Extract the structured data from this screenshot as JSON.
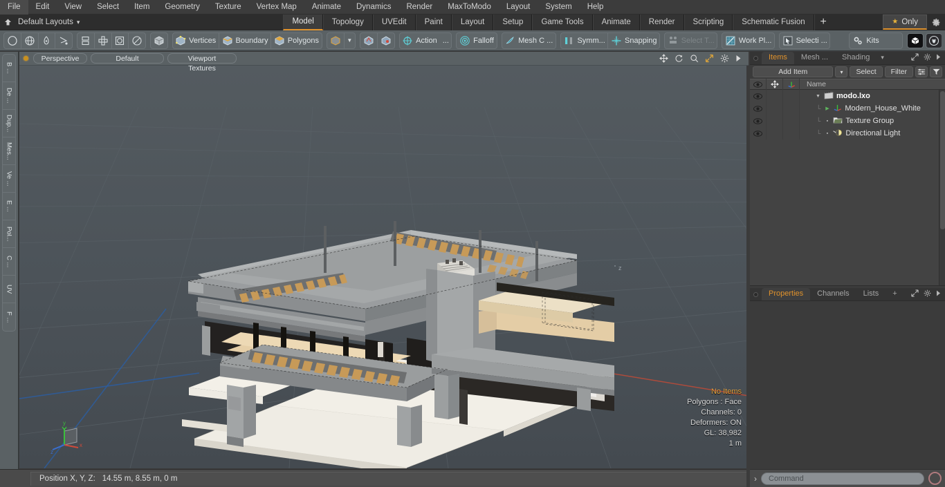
{
  "app": {
    "title": "Modo",
    "accent": "#e0922c",
    "toolbar_bg": "#5a6164",
    "viewport_bg": "#4e565c"
  },
  "menubar": {
    "items": [
      {
        "label": "File"
      },
      {
        "label": "Edit"
      },
      {
        "label": "View"
      },
      {
        "label": "Select"
      },
      {
        "label": "Item"
      },
      {
        "label": "Geometry"
      },
      {
        "label": "Texture"
      },
      {
        "label": "Vertex Map"
      },
      {
        "label": "Animate"
      },
      {
        "label": "Dynamics"
      },
      {
        "label": "Render"
      },
      {
        "label": "MaxToModo"
      },
      {
        "label": "Layout"
      },
      {
        "label": "System"
      },
      {
        "label": "Help"
      }
    ]
  },
  "layoutbar": {
    "home_icon": "home-icon",
    "layouts_label": "Default Layouts",
    "dropdown_glyph": "▾",
    "tabs": [
      {
        "label": "Model",
        "active": true
      },
      {
        "label": "Topology",
        "active": false
      },
      {
        "label": "UVEdit",
        "active": false
      },
      {
        "label": "Paint",
        "active": false
      },
      {
        "label": "Layout",
        "active": false
      },
      {
        "label": "Setup",
        "active": false
      },
      {
        "label": "Game Tools",
        "active": false
      },
      {
        "label": "Animate",
        "active": false
      },
      {
        "label": "Render",
        "active": false
      },
      {
        "label": "Scripting",
        "active": false
      },
      {
        "label": "Schematic Fusion",
        "active": false
      }
    ],
    "add_tab_label": "+",
    "only_label": "Only",
    "only_star": "★",
    "gear_icon": "gear-icon"
  },
  "toolbar": {
    "groups": [
      {
        "name": "primitives",
        "buttons": [
          {
            "icon": "circle-icon",
            "label": ""
          },
          {
            "icon": "globe-icon",
            "label": ""
          },
          {
            "icon": "pen-icon",
            "label": ""
          },
          {
            "icon": "curve-icon",
            "label": ""
          }
        ]
      },
      {
        "name": "duplicate-tools",
        "buttons": [
          {
            "icon": "stack-icon",
            "label": ""
          },
          {
            "icon": "radial-array-icon",
            "label": ""
          },
          {
            "icon": "bounding-box-icon",
            "label": ""
          },
          {
            "icon": "ellipse-icon",
            "label": ""
          }
        ]
      },
      {
        "name": "item-mode",
        "buttons": [
          {
            "icon": "cube-icon",
            "label": ""
          }
        ]
      },
      {
        "name": "selection-modes",
        "buttons": [
          {
            "icon": "vertices-icon",
            "label": "Vertices"
          },
          {
            "icon": "boundary-icon",
            "label": "Boundary"
          },
          {
            "icon": "polygons-icon",
            "label": "Polygons"
          }
        ]
      },
      {
        "name": "selection-extras",
        "buttons": [
          {
            "icon": "cube-orange-icon",
            "label": ""
          },
          {
            "icon": "chevron-down-icon",
            "label": ""
          }
        ]
      },
      {
        "name": "select-helpers",
        "buttons": [
          {
            "icon": "select-through-icon",
            "label": ""
          },
          {
            "icon": "select-backface-icon",
            "label": ""
          }
        ]
      },
      {
        "name": "action-center",
        "buttons": [
          {
            "icon": "action-center-icon",
            "label": "Action"
          },
          {
            "icon": "ellipsis-icon",
            "label": "..."
          }
        ]
      },
      {
        "name": "falloff",
        "buttons": [
          {
            "icon": "falloff-icon",
            "label": "Falloff"
          }
        ]
      },
      {
        "name": "mesh-constraint",
        "buttons": [
          {
            "icon": "mesh-constraint-icon",
            "label": "Mesh C ..."
          }
        ]
      },
      {
        "name": "symmetry-snapping",
        "buttons": [
          {
            "icon": "symmetry-icon",
            "label": "Symm..."
          },
          {
            "icon": "snapping-icon",
            "label": "Snapping"
          }
        ]
      },
      {
        "name": "select-through",
        "buttons": [
          {
            "icon": "select-through-icon",
            "label": "Select T...",
            "dim": true
          }
        ]
      },
      {
        "name": "work-plane",
        "buttons": [
          {
            "icon": "work-plane-icon",
            "label": "Work Pl..."
          }
        ]
      },
      {
        "name": "selection-sets",
        "buttons": [
          {
            "icon": "selection-icon",
            "label": "Selecti ..."
          }
        ]
      },
      {
        "name": "kits",
        "buttons": [
          {
            "icon": "kits-gear-icon",
            "label": "Kits"
          }
        ]
      },
      {
        "name": "plugins",
        "buttons": [
          {
            "icon": "modo-cube-icon",
            "label": ""
          },
          {
            "icon": "unreal-engine-icon",
            "label": ""
          }
        ]
      }
    ]
  },
  "left_strip": {
    "tabs": [
      {
        "label": "B ..."
      },
      {
        "label": "De ..."
      },
      {
        "label": "Dup..."
      },
      {
        "label": "Mes..."
      },
      {
        "label": "Ve ..."
      },
      {
        "label": "E ..."
      },
      {
        "label": "Pol..."
      },
      {
        "label": "C ..."
      },
      {
        "label": "UV"
      },
      {
        "label": "F ..."
      }
    ]
  },
  "viewport": {
    "header": {
      "active_dot": true,
      "pills": [
        {
          "label": "Perspective",
          "name": "viewport-projection-dropdown"
        },
        {
          "label": "Default",
          "name": "viewport-style-dropdown"
        },
        {
          "label": "Viewport Textures",
          "name": "viewport-textures-dropdown"
        }
      ],
      "tools": [
        {
          "icon": "pan-icon"
        },
        {
          "icon": "rotate-icon"
        },
        {
          "icon": "zoom-icon"
        },
        {
          "icon": "fit-icon"
        },
        {
          "icon": "gear-icon"
        },
        {
          "icon": "play-arrow-icon"
        }
      ]
    },
    "stats": {
      "no_items": "No Items",
      "polygons": "Polygons : Face",
      "channels": "Channels: 0",
      "deformers": "Deformers: ON",
      "gl": "GL: 38,982",
      "grid_unit": "1 m"
    },
    "axis_gizmo": {
      "x": "x",
      "y": "y",
      "z": "z"
    }
  },
  "statusbar": {
    "position_label": "Position X, Y, Z:",
    "position_value": "14.55 m, 8.55 m, 0 m"
  },
  "right_panel": {
    "top_tabs": [
      {
        "label": "Items",
        "active": true
      },
      {
        "label": "Mesh ...",
        "active": false
      },
      {
        "label": "Shading",
        "active": false
      }
    ],
    "top_tabs_dropdown": "▾",
    "items_toolbar": {
      "add_item": "Add Item",
      "add_item_dropdown": "▾",
      "select": "Select",
      "filter": "Filter",
      "list_icon": "list-options-icon",
      "funnel_icon": "funnel-icon"
    },
    "columns": {
      "eye": "eye-icon",
      "lock": "move-lock-icon",
      "axis": "axis-icon",
      "name": "Name"
    },
    "tree": [
      {
        "label": "modo.lxo",
        "icon": "scene-icon",
        "depth": 0,
        "expander": "▼",
        "root": true
      },
      {
        "label": "Modern_House_White",
        "icon": "mesh-axis-icon",
        "depth": 1,
        "expander": "▶",
        "root": false
      },
      {
        "label": "Texture Group",
        "icon": "texture-group-icon",
        "depth": 1,
        "expander": "",
        "root": false
      },
      {
        "label": "Directional Light",
        "icon": "light-icon",
        "depth": 1,
        "expander": "",
        "root": false
      }
    ],
    "props_tabs": [
      {
        "label": "Properties",
        "active": true
      },
      {
        "label": "Channels",
        "active": false
      },
      {
        "label": "Lists",
        "active": false
      },
      {
        "label": "+",
        "active": false
      }
    ],
    "command": {
      "prompt": "›",
      "placeholder": "Command",
      "record_icon": "record-icon"
    }
  }
}
